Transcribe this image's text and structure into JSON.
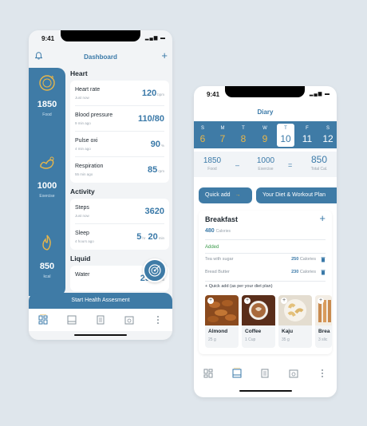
{
  "dashboard": {
    "status_time": "9:41",
    "title": "Dashboard",
    "plus": "+",
    "sidebar": [
      {
        "value": "1850",
        "label": "Food",
        "icon": "food-plate-icon"
      },
      {
        "value": "1000",
        "label": "Exercise",
        "icon": "exercise-arm-icon"
      },
      {
        "value": "850",
        "label": "kcal",
        "icon": "flame-icon"
      }
    ],
    "sections": {
      "heart_title": "Heart",
      "liquid_title": "Liquid",
      "activity_title": "Activity"
    },
    "heart": [
      {
        "name": "Heart rate",
        "time": "Just now",
        "value": "120",
        "unit": "bpm"
      },
      {
        "name": "Blood pressure",
        "time": "9 min ago",
        "value": "110/80",
        "unit": ""
      },
      {
        "name": "Pulse oxi",
        "time": "4 min ago",
        "value": "90",
        "unit": "%"
      },
      {
        "name": "Respiration",
        "time": "55 min ago",
        "value": "85",
        "unit": "rpm"
      }
    ],
    "activity": [
      {
        "name": "Steps",
        "time": "Just now",
        "value": "3620",
        "unit": ""
      },
      {
        "name": "Sleep",
        "time": "4 hours ago",
        "value_h": "5",
        "unit_h": "hr",
        "value_m": "20",
        "unit_m": "min"
      }
    ],
    "liquid": [
      {
        "name": "Water",
        "value": "2520",
        "unit": "ml"
      }
    ],
    "cta": "Start Health Assesment",
    "accent": "#3f7ba6"
  },
  "diary": {
    "status_time": "9:41",
    "title": "Diary",
    "week": [
      {
        "letter": "S",
        "num": "6"
      },
      {
        "letter": "M",
        "num": "7"
      },
      {
        "letter": "T",
        "num": "8"
      },
      {
        "letter": "W",
        "num": "9"
      },
      {
        "letter": "T",
        "num": "10"
      },
      {
        "letter": "F",
        "num": "11"
      },
      {
        "letter": "S",
        "num": "12"
      }
    ],
    "calories": {
      "food_value": "1850",
      "food_label": "Food",
      "minus": "–",
      "exercise_value": "1000",
      "exercise_label": "Exercise",
      "equals": "=",
      "total_value": "850",
      "total_label": "Total Cal."
    },
    "buttons": {
      "quick_add": "Quick add",
      "arrow": "→",
      "plan": "Your Diet & Workout Plan"
    },
    "breakfast": {
      "title": "Breakfast",
      "plus": "+",
      "calories_value": "480",
      "calories_unit": "Calories",
      "added_label": "Added",
      "items": [
        {
          "name": "Tea with sugar",
          "value": "250",
          "unit": "Calories"
        },
        {
          "name": "Bread Butter",
          "value": "230",
          "unit": "Calories"
        }
      ],
      "quick_label": "+ Quick add (as per your diet plan)",
      "foods": [
        {
          "name": "Almond",
          "qty": "25 g"
        },
        {
          "name": "Coffee",
          "qty": "1 Cup"
        },
        {
          "name": "Kaju",
          "qty": "35 g"
        },
        {
          "name": "Brea",
          "qty": "3 slic"
        }
      ]
    }
  }
}
